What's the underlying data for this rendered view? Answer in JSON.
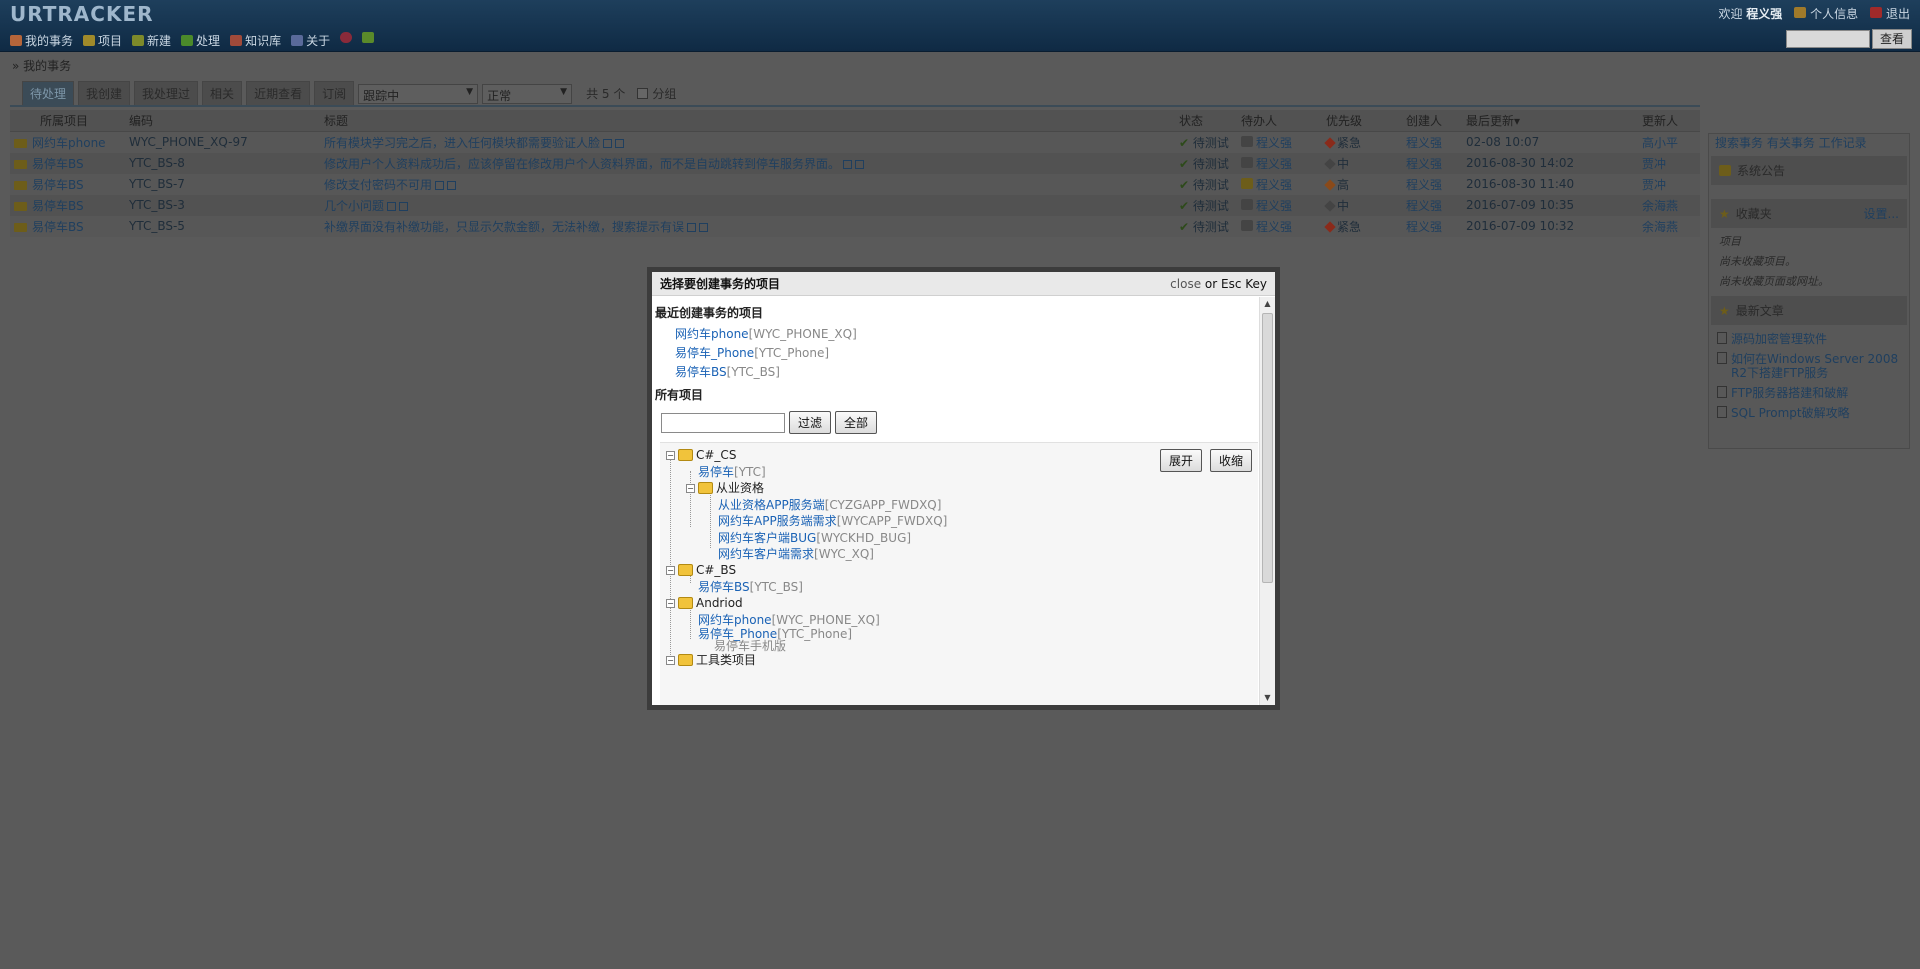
{
  "header": {
    "logo": "URTRACKER",
    "nav": [
      {
        "label": "我的事务",
        "icon": "home-icon",
        "color": "#b5653a"
      },
      {
        "label": "项目",
        "icon": "project-icon",
        "color": "#a08a2a"
      },
      {
        "label": "新建",
        "icon": "new-icon",
        "color": "#7d8a2a"
      },
      {
        "label": "处理",
        "icon": "check-icon",
        "color": "#4b8a2a"
      },
      {
        "label": "知识库",
        "icon": "book-icon",
        "color": "#a04a3a"
      },
      {
        "label": "关于",
        "icon": "info-icon",
        "color": "#5a6a9a"
      }
    ],
    "welcome": "欢迎",
    "username": "程义强",
    "profile_label": "个人信息",
    "logout_label": "退出",
    "search_button": "查看"
  },
  "breadcrumb": "» 我的事务",
  "tabs": [
    "待处理",
    "我创建",
    "我处理过",
    "相关",
    "近期查看",
    "订阅"
  ],
  "active_tab": 0,
  "filters": {
    "status_select": "跟踪中",
    "type_select": "正常",
    "count_text": "共 5 个",
    "group_label": "分组"
  },
  "table": {
    "headers": [
      "所属项目",
      "编码",
      "标题",
      "状态",
      "待办人",
      "优先级",
      "创建人",
      "最后更新▾",
      "更新人"
    ],
    "rows": [
      {
        "project": "网约车phone",
        "code": "WYC_PHONE_XQ-97",
        "title": "所有模块学习完之后，进入任何模块都需要验证人脸",
        "status": "待测试",
        "assignee": "程义强",
        "priority": "紧急",
        "priority_color": "#8a2a1a",
        "creator": "程义强",
        "updated": "02-08 10:07",
        "updater": "高小平"
      },
      {
        "project": "易停车BS",
        "code": "YTC_BS-8",
        "title": "修改用户个人资料成功后，应该停留在修改用户个人资料界面，而不是自动跳转到停车服务界面。",
        "status": "待测试",
        "assignee": "程义强",
        "priority": "中",
        "priority_color": "#444444",
        "creator": "程义强",
        "updated": "2016-08-30 14:02",
        "updater": "贾冲"
      },
      {
        "project": "易停车BS",
        "code": "YTC_BS-7",
        "title": "修改支付密码不可用",
        "status": "待测试",
        "assignee": "程义强",
        "priority": "高",
        "priority_color": "#8a4a1a",
        "creator": "程义强",
        "updated": "2016-08-30 11:40",
        "updater": "贾冲"
      },
      {
        "project": "易停车BS",
        "code": "YTC_BS-3",
        "title": "几个小问题",
        "status": "待测试",
        "assignee": "程义强",
        "priority": "中",
        "priority_color": "#444444",
        "creator": "程义强",
        "updated": "2016-07-09 10:35",
        "updater": "余海燕"
      },
      {
        "project": "易停车BS",
        "code": "YTC_BS-5",
        "title": "补缴界面没有补缴功能，只显示欠款金额，无法补缴，搜索提示有误",
        "status": "待测试",
        "assignee": "程义强",
        "priority": "紧急",
        "priority_color": "#8a2a1a",
        "creator": "程义强",
        "updated": "2016-07-09 10:32",
        "updater": "余海燕"
      }
    ]
  },
  "right_panel": {
    "links": "搜索事务  有关事务  工作记录",
    "notice_title": "系统公告",
    "favorites_title": "收藏夹",
    "favorites_setting": "设置...",
    "fav_notes": [
      "项目",
      "尚未收藏项目。",
      "尚未收藏页面或网址。"
    ],
    "articles_title": "最新文章",
    "articles": [
      "源码加密管理软件",
      "如何在Windows Server 2008 R2下搭建FTP服务",
      "FTP服务器搭建和破解",
      "SQL Prompt破解攻略"
    ]
  },
  "modal": {
    "title": "选择要创建事务的项目",
    "close_label": "close",
    "close_hint": " or Esc Key",
    "recent_title": "最近创建事务的项目",
    "recent": [
      {
        "name": "网约车phone",
        "code": "[WYC_PHONE_XQ]"
      },
      {
        "name": "易停车_Phone",
        "code": "[YTC_Phone]"
      },
      {
        "name": "易停车BS",
        "code": "[YTC_BS]"
      }
    ],
    "all_title": "所有项目",
    "filter_button": "过滤",
    "all_button": "全部",
    "expand_button": "展开",
    "collapse_button": "收缩",
    "tree": [
      {
        "type": "folder",
        "label": "C#_CS"
      },
      {
        "type": "leaf",
        "name": "易停车",
        "code": "[YTC]"
      },
      {
        "type": "folder",
        "label": "从业资格"
      },
      {
        "type": "leaf",
        "name": "从业资格APP服务端",
        "code": "[CYZGAPP_FWDXQ]"
      },
      {
        "type": "leaf",
        "name": "网约车APP服务端需求",
        "code": "[WYCAPP_FWDXQ]"
      },
      {
        "type": "leaf",
        "name": "网约车客户端BUG",
        "code": "[WYCKHD_BUG]"
      },
      {
        "type": "leaf",
        "name": "网约车客户端需求",
        "code": "[WYC_XQ]"
      },
      {
        "type": "folder",
        "label": "C#_BS"
      },
      {
        "type": "leaf",
        "name": "易停车BS",
        "code": "[YTC_BS]"
      },
      {
        "type": "folder",
        "label": "Andriod"
      },
      {
        "type": "leaf",
        "name": "网约车phone",
        "code": "[WYC_PHONE_XQ]"
      },
      {
        "type": "leaf",
        "name": "易停车_Phone",
        "code": "[YTC_Phone]"
      },
      {
        "type": "text",
        "label": "易停车手机版"
      },
      {
        "type": "folder",
        "label": "工具类项目"
      }
    ]
  }
}
